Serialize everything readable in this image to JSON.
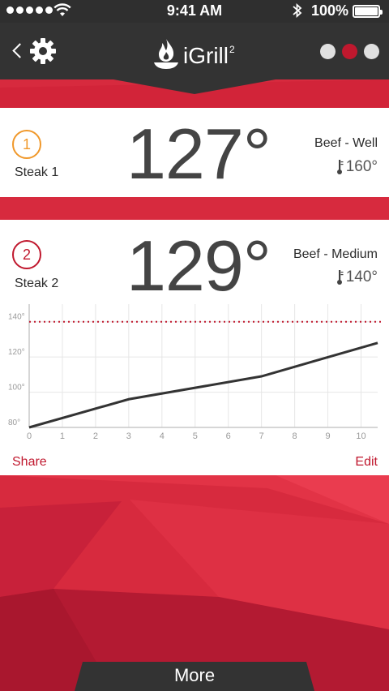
{
  "status": {
    "time": "9:41 AM",
    "battery_pct": "100%"
  },
  "navbar": {
    "brand": "iGrill",
    "brand_sup": "2",
    "back_icon": "chevron-left-icon",
    "settings_icon": "gear-icon",
    "page_dots": [
      {
        "active": false
      },
      {
        "active": true
      },
      {
        "active": false
      }
    ]
  },
  "probes": [
    {
      "number": "1",
      "name": "Steak 1",
      "temp": "127°",
      "preset": "Beef - Well",
      "target": "160°",
      "color": "#f0982a"
    },
    {
      "number": "2",
      "name": "Steak 2",
      "temp": "129°",
      "preset": "Beef - Medium",
      "target": "140°",
      "color": "#c0182e"
    }
  ],
  "actions": {
    "share": "Share",
    "edit": "Edit"
  },
  "chart_data": {
    "type": "line",
    "x": [
      0,
      3,
      7,
      10.5
    ],
    "series": [
      {
        "values": [
          80,
          96,
          109,
          128
        ]
      }
    ],
    "target_line": 140,
    "xticks": [
      "0",
      "1",
      "2",
      "3",
      "4",
      "5",
      "6",
      "7",
      "8",
      "9",
      "10"
    ],
    "yticks": [
      "80°",
      "100°",
      "120°",
      "140°"
    ],
    "xlim": [
      0,
      10.5
    ],
    "ylim": [
      80,
      150
    ],
    "grid": true,
    "line_color": "#333333",
    "target_color": "#c0182e"
  },
  "footer": {
    "more_label": "More"
  },
  "colors": {
    "accent": "#d72a3e",
    "dark": "#333333"
  }
}
